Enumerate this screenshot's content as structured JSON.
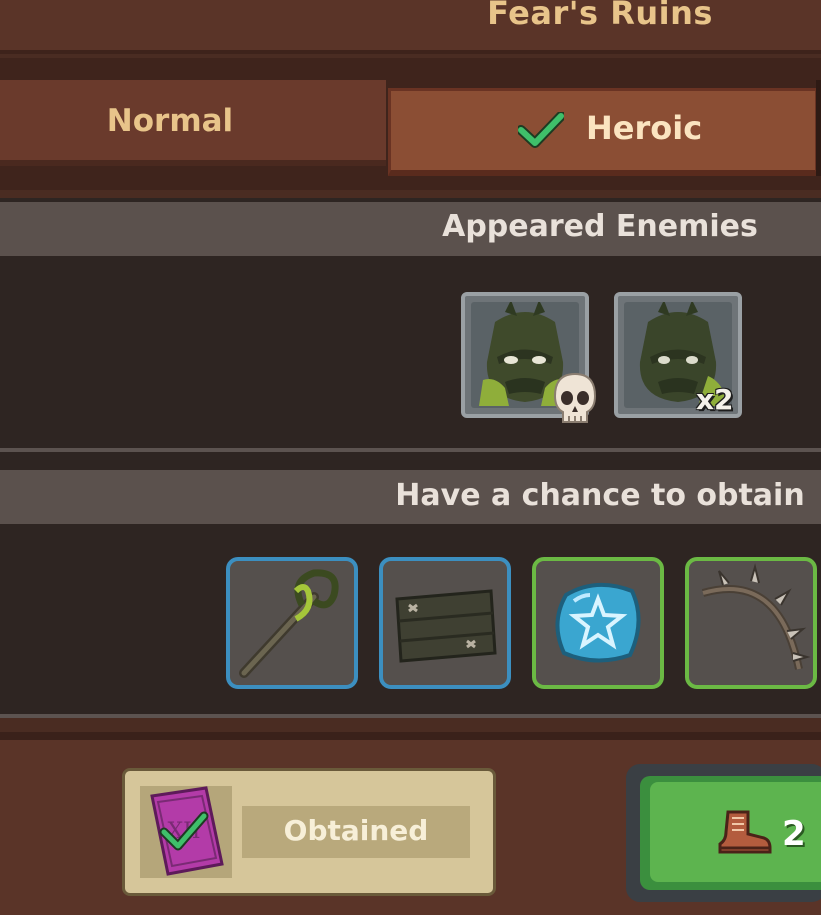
{
  "header": {
    "title": "Fear's Ruins"
  },
  "tabs": [
    {
      "label": "Normal",
      "selected": false
    },
    {
      "label": "Heroic",
      "selected": true
    }
  ],
  "enemies_section": {
    "title": "Appeared Enemies",
    "enemies": [
      {
        "name": "orc-boss",
        "boss": true,
        "icon": "skull-icon"
      },
      {
        "name": "orc",
        "count_label": "x2"
      }
    ]
  },
  "rewards_section": {
    "title": "Have a chance to obtain",
    "items": [
      {
        "name": "vine-staff",
        "rarity_color": "#3c8fc0"
      },
      {
        "name": "wooden-plank-shield",
        "rarity_color": "#3c8fc0"
      },
      {
        "name": "blue-star-rune",
        "rarity_color": "#6bb944"
      },
      {
        "name": "thorn-bow",
        "rarity_color": "#6bb944"
      }
    ]
  },
  "footer": {
    "obtained_label": "Obtained",
    "play_cost": "2",
    "play_icon": "boot-icon"
  },
  "colors": {
    "accent_gold": "#e8c48a",
    "play_green": "#5db44f",
    "check_green": "#3fbf6a"
  }
}
